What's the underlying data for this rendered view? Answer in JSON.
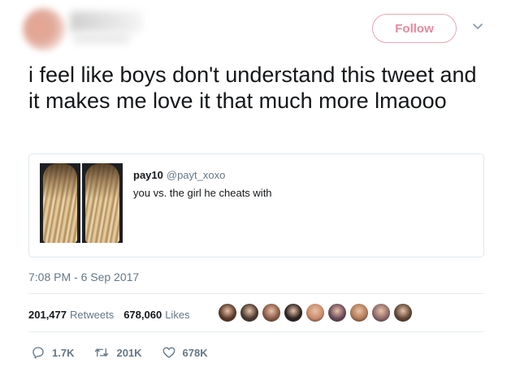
{
  "header": {
    "follow_label": "Follow"
  },
  "tweet": {
    "text": "i feel like boys don't understand this tweet and it makes me love it that much more lmaooo",
    "timestamp": "7:08 PM - 6 Sep 2017"
  },
  "quote": {
    "name": "pay10",
    "handle": "@payt_xoxo",
    "text": "you vs. the girl he cheats with"
  },
  "stats": {
    "retweets_count": "201,477",
    "retweets_label": "Retweets",
    "likes_count": "678,060",
    "likes_label": "Likes"
  },
  "likers": [
    "#5a3a2a",
    "#4a3b30",
    "#8a5a48",
    "#2b2320",
    "#c98a6a",
    "#6b4a5a",
    "#b27a55",
    "#8f6a6a",
    "#5e4636"
  ],
  "actions": {
    "replies": "1.7K",
    "retweets": "201K",
    "likes": "678K"
  },
  "colors": {
    "accent_follow": "#e7889c",
    "muted_text": "#657786",
    "border": "#e1e8ed"
  }
}
